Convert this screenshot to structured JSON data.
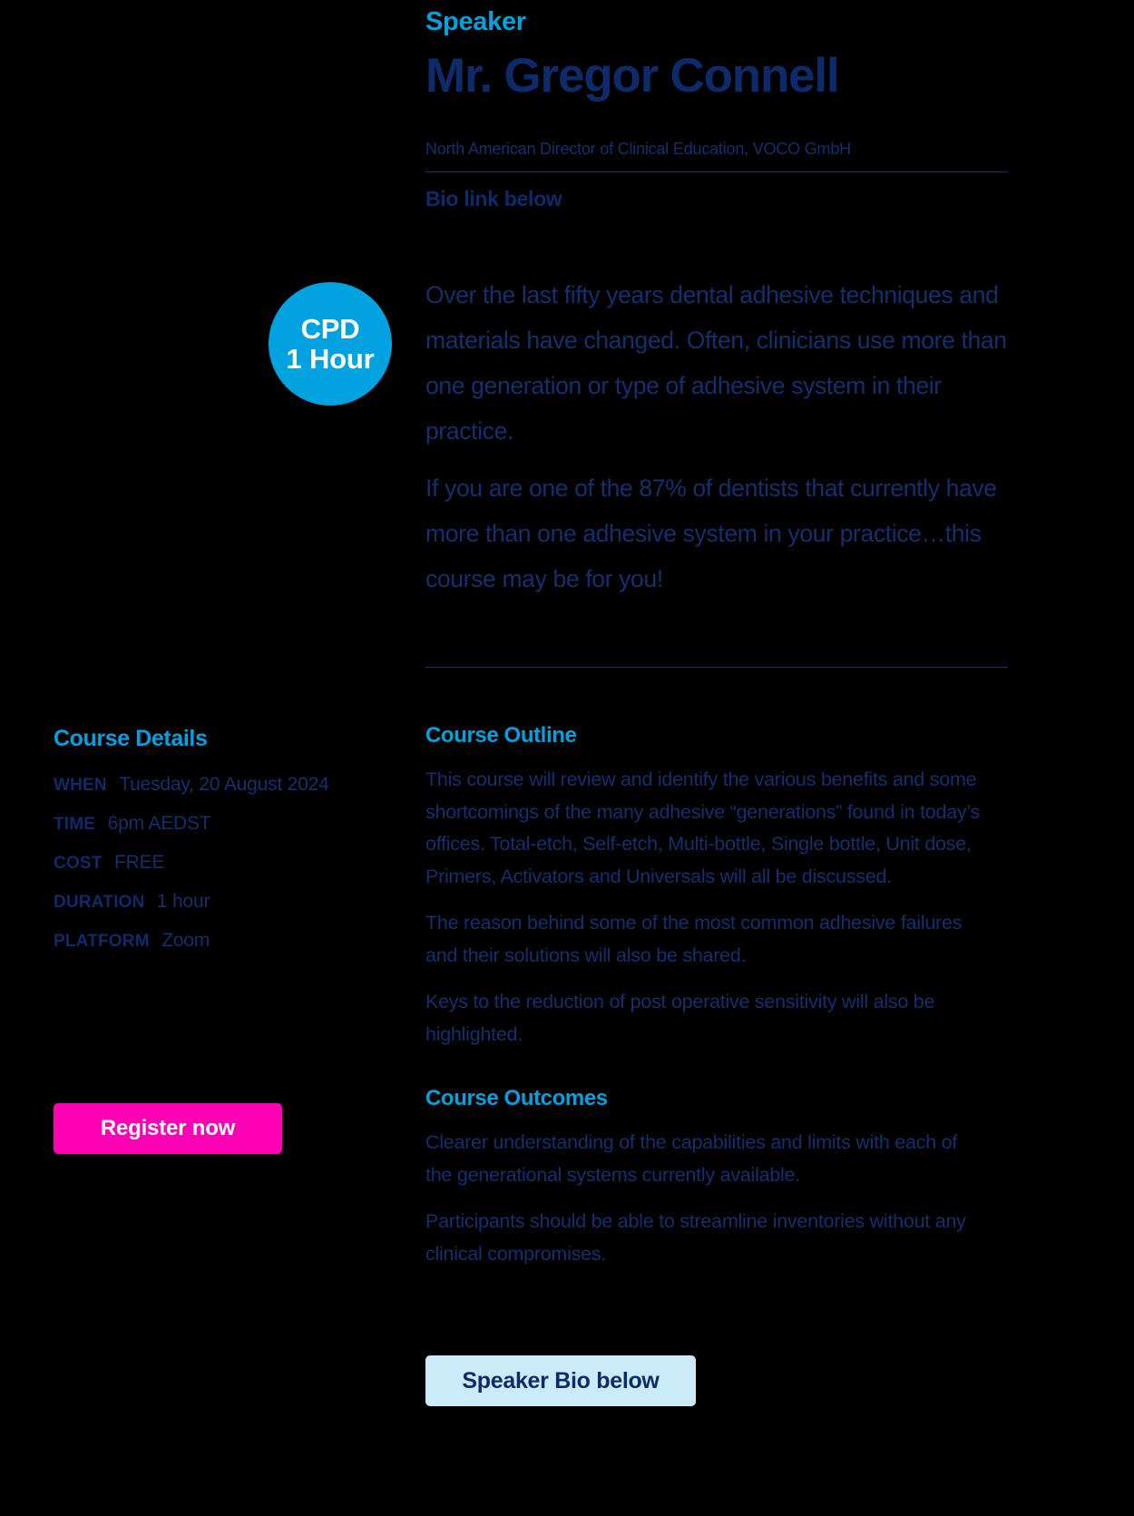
{
  "speaker": {
    "kicker": "Speaker",
    "name": "Mr. Gregor Connell",
    "role": "North American Director of  Clinical Education, VOCO GmbH",
    "bio_link_label": "Bio link below"
  },
  "cpd_badge": {
    "line1": "CPD",
    "line2": "1 Hour"
  },
  "intro": {
    "paragraph1": "Over the last fifty years dental adhesive techniques and materials have changed. Often, clinicians use more than one generation or type of adhesive system in their practice.",
    "paragraph2": "If you are one of the 87% of dentists that currently have more than one adhesive system in your practice…this course may be for you!"
  },
  "course_details": {
    "heading": "Course Details",
    "rows": [
      {
        "label": "WHEN",
        "value": "Tuesday, 20 August 2024"
      },
      {
        "label": "TIME",
        "value": "6pm AEDST"
      },
      {
        "label": "COST",
        "value": "FREE"
      },
      {
        "label": "DURATION",
        "value": "1 hour"
      },
      {
        "label": "PLATFORM",
        "value": "Zoom"
      }
    ]
  },
  "register_button": {
    "label": "Register now"
  },
  "course_outline": {
    "heading": "Course Outline",
    "paragraphs": [
      "This course will review and identify the various benefits and some shortcomings of the many adhesive “generations” found in today’s offices. Total-etch, Self-etch, Multi-bottle, Single bottle, Unit dose, Primers, Activators and Universals will all be discussed.",
      "The reason behind some of the most common adhesive failures and their solutions will also be shared.",
      "Keys to the reduction of post operative sensitivity will also be highlighted."
    ]
  },
  "course_outcomes": {
    "heading": "Course Outcomes",
    "paragraphs": [
      "Clearer understanding of the capabilities and limits with each of the generational systems currently available.",
      "Participants should be able to streamline inventories without any clinical compromises."
    ]
  },
  "bio_button": {
    "label": "Speaker Bio below"
  },
  "colors": {
    "background": "#000000",
    "cyan": "#00A3E0",
    "navy": "#0D2B6B",
    "magenta": "#FF00B4",
    "light_blue": "#CCEBF8"
  }
}
